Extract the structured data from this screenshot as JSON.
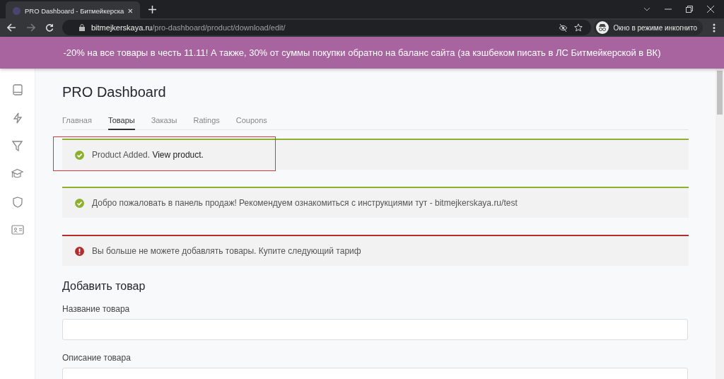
{
  "browser": {
    "tab_title": "PRO Dashboard - Битмейкерска",
    "url_host": "bitmejkerskaya.ru",
    "url_path": "/pro-dashboard/product/download/edit/",
    "incognito_label": "Окно в режиме инкогнито"
  },
  "promo_banner": "-20% на все товары в честь 11.11! А также, 30% от суммы покупки обратно на баланс сайта (за кэшбеком писать в ЛС Битмейкерской в ВК)",
  "page_title": "PRO Dashboard",
  "tabs": [
    {
      "label": "Главная",
      "selected": false
    },
    {
      "label": "Товары",
      "selected": true
    },
    {
      "label": "Заказы",
      "selected": false
    },
    {
      "label": "Ratings",
      "selected": false
    },
    {
      "label": "Coupons",
      "selected": false
    }
  ],
  "notices": [
    {
      "kind": "success",
      "text": "Product Added.",
      "link": "View product.",
      "highlighted": true
    },
    {
      "kind": "success",
      "text": "Добро пожаловать в панель продаж! Рекомендуем ознакомиться с инструкциями тут - bitmejkerskaya.ru/test",
      "highlighted": false
    },
    {
      "kind": "error",
      "text": "Вы больше не можете добавлять товары. Купите следующий тариф",
      "highlighted": false
    }
  ],
  "form": {
    "title": "Добавить товар",
    "fields": [
      {
        "label": "Название товара"
      },
      {
        "label": "Описание товара"
      }
    ]
  }
}
